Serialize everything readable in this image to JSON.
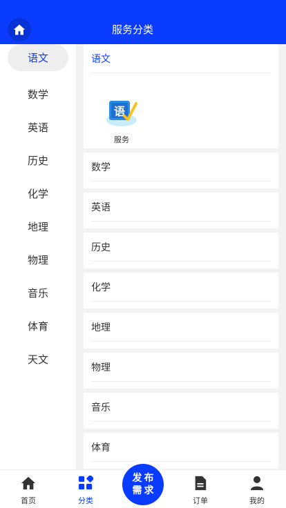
{
  "header": {
    "title": "服务分类"
  },
  "sidebar": {
    "items": [
      "语文",
      "数学",
      "英语",
      "历史",
      "化学",
      "地理",
      "物理",
      "音乐",
      "体育",
      "天文"
    ],
    "active_index": 0
  },
  "content": {
    "first_category": "语文",
    "service": {
      "icon_glyph": "语",
      "label": "服务"
    },
    "categories": [
      "数学",
      "英语",
      "历史",
      "化学",
      "地理",
      "物理",
      "音乐",
      "体育"
    ]
  },
  "tabbar": {
    "home": "首页",
    "category": "分类",
    "publish_line1": "发布",
    "publish_line2": "需求",
    "orders": "订单",
    "mine": "我的"
  },
  "colors": {
    "accent": "#0a3cff",
    "background": "#f2f2f2"
  }
}
